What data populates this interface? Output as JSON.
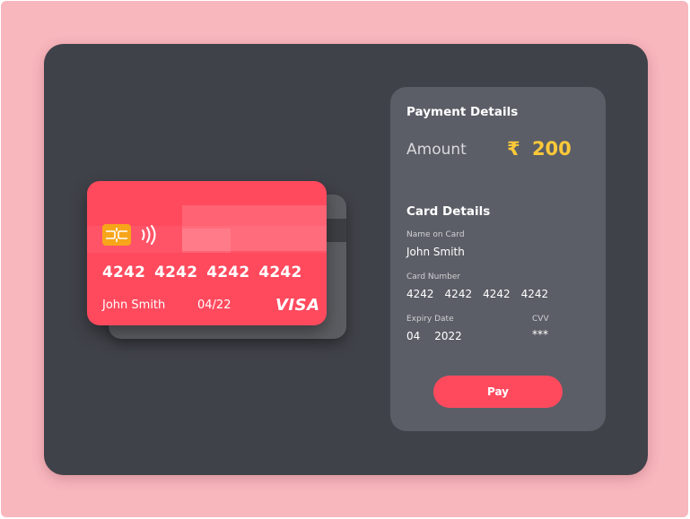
{
  "card": {
    "number_groups": [
      "4242",
      "4242",
      "4242",
      "4242"
    ],
    "holder_name": "John Smith",
    "expiry": "04/22",
    "brand": "VISA",
    "chip_icon": "card-chip-icon",
    "contactless_icon": "contactless-icon"
  },
  "payment": {
    "title": "Payment Details",
    "amount_label": "Amount",
    "currency_symbol": "₹",
    "amount_value": "200",
    "card_details_title": "Card Details",
    "name_label": "Name on Card",
    "name_value": "John Smith",
    "number_label": "Card Number",
    "number_groups": [
      "4242",
      "4242",
      "4242",
      "4242"
    ],
    "expiry_label": "Expiry Date",
    "expiry_month": "04",
    "expiry_year": "2022",
    "cvv_label": "CVV",
    "cvv_value": "***",
    "pay_label": "Pay"
  },
  "colors": {
    "background": "#f8b6bd",
    "panel": "#404249",
    "card_accent": "#ff4a5e",
    "details_panel": "#5b5e66",
    "amount": "#fdc938"
  }
}
